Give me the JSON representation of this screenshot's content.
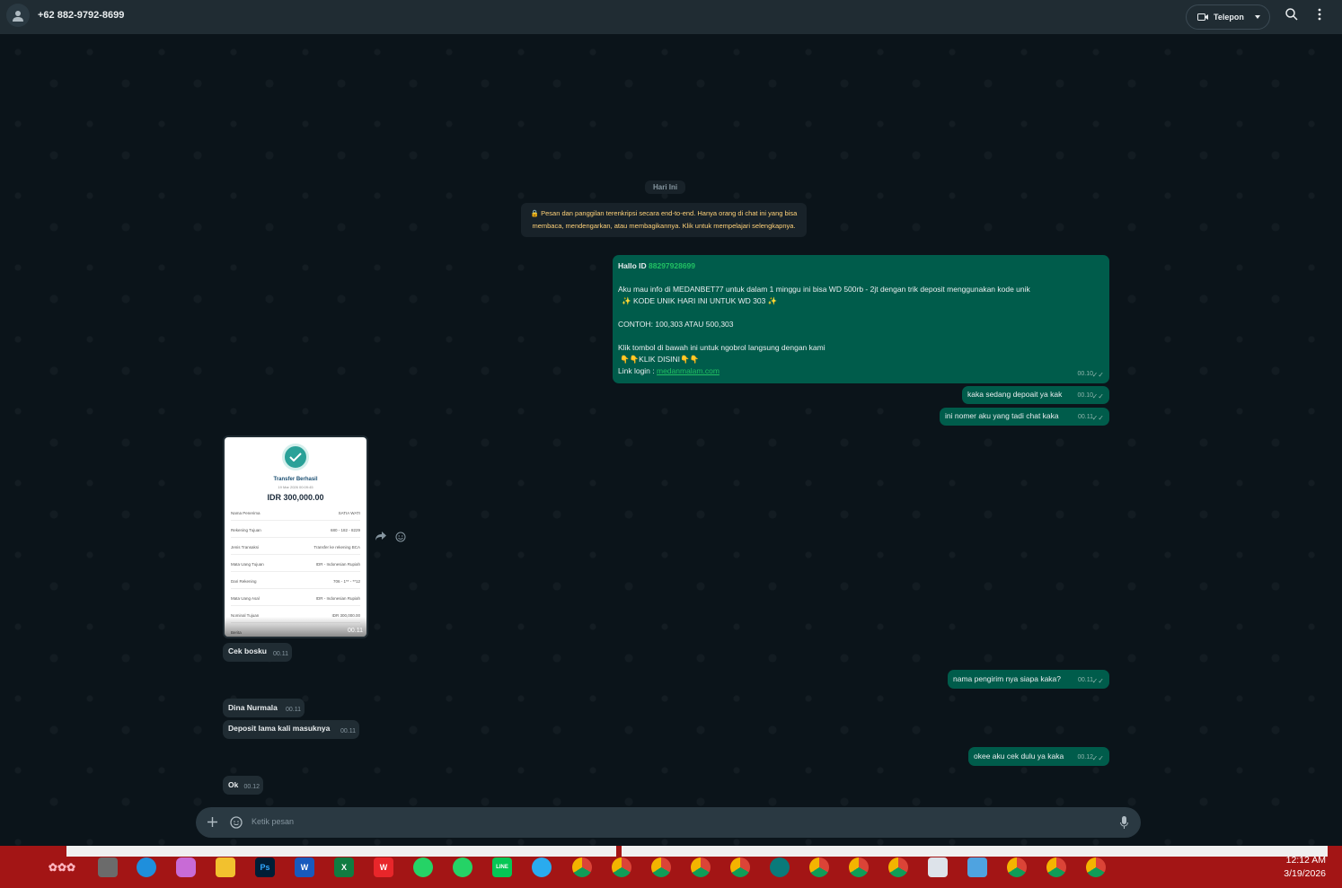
{
  "header": {
    "contact_name": "+62 882-9792-8699",
    "call_label": "Telepon"
  },
  "chat": {
    "date_label": "Hari Ini",
    "encryption_notice": "🔒 Pesan dan panggilan terenkripsi secara end-to-end. Hanya orang di chat ini yang bisa membaca, mendengarkan, atau membagikannya. Klik untuk mempelajari selengkapnya.",
    "first_message": {
      "hallo_prefix": "Hallo ID ",
      "hallo_id": "88297928699",
      "line_info": "Aku mau info di MEDANBET77 untuk dalam 1 minggu ini bisa WD 500rb - 2jt dengan trik deposit menggunakan kode unik",
      "line_code": "✨  KODE UNIK HARI INI UNTUK WD 303  ✨",
      "line_example": "CONTOH: 100,303 ATAU 500,303",
      "line_cta": "Klik tombol di bawah ini untuk ngobrol langsung dengan kami",
      "line_click": "👇👇KLIK DISINI👇👇",
      "login_prefix": "Link login : ",
      "login_link": "medanmalam.com",
      "time": "00.10"
    },
    "messages": [
      {
        "text": "kaka sedang depoait ya kak",
        "time": "00.10"
      },
      {
        "text": "ini nomer aku yang tadi chat kaka",
        "time": "00.11"
      },
      {
        "text": "Cek bosku",
        "time": "00.11"
      },
      {
        "text": "nama pengirim nya siapa kaka?",
        "time": "00.11"
      },
      {
        "text": "Dina Nurmala",
        "time": "00.11"
      },
      {
        "text": "Deposit lama kali masuknya",
        "time": "00.11"
      },
      {
        "text": "okee aku cek dulu ya kaka",
        "time": "00.12"
      },
      {
        "text": "Ok",
        "time": "00.12"
      }
    ],
    "receipt": {
      "title": "Transfer Berhasil",
      "date": "19 Mar 2026 00:09:45",
      "amount": "IDR 300,000.00",
      "time": "00.11",
      "rows": [
        {
          "label": "Nama Penerima",
          "value": "SATIA WATI"
        },
        {
          "label": "Rekening Tujuan",
          "value": "680 - 182 - 8229"
        },
        {
          "label": "Jenis Transaksi",
          "value": "Transfer ke rekening BCA"
        },
        {
          "label": "Mata Uang Tujuan",
          "value": "IDR - Indonesian Rupiah"
        },
        {
          "label": "Dari Rekening",
          "value": "706 - 1** - **12"
        },
        {
          "label": "Mata Uang Asal",
          "value": "IDR - Indonesian Rupiah"
        },
        {
          "label": "Nominal Tujuan",
          "value": "IDR 300,000.00"
        },
        {
          "label": "Berita",
          "value": ""
        }
      ]
    }
  },
  "composer": {
    "placeholder": "Ketik pesan"
  },
  "taskbar": {
    "time": "12:12 AM",
    "date": "3/19/2026",
    "apps": [
      "windows-sakura-icon",
      "file-explorer-icon",
      "edge-icon",
      "copilot-icon",
      "folder-icon",
      "photoshop-icon",
      "word-icon",
      "excel-icon",
      "wps-icon",
      "whatsapp-icon",
      "whatsapp-business-icon",
      "line-icon",
      "telegram-icon",
      "chrome-icon",
      "chrome-icon",
      "chrome-icon",
      "chrome-icon",
      "chrome-icon",
      "greenhead-icon",
      "chrome-icon",
      "chrome-icon",
      "chrome-icon",
      "pocket-icon",
      "notepad-icon",
      "chrome-icon",
      "chrome-icon",
      "chrome-icon"
    ]
  },
  "colors": {
    "outgoing": "#005c4b",
    "incoming": "#202c33",
    "background": "#0b141a",
    "taskbar": "#a31515"
  }
}
